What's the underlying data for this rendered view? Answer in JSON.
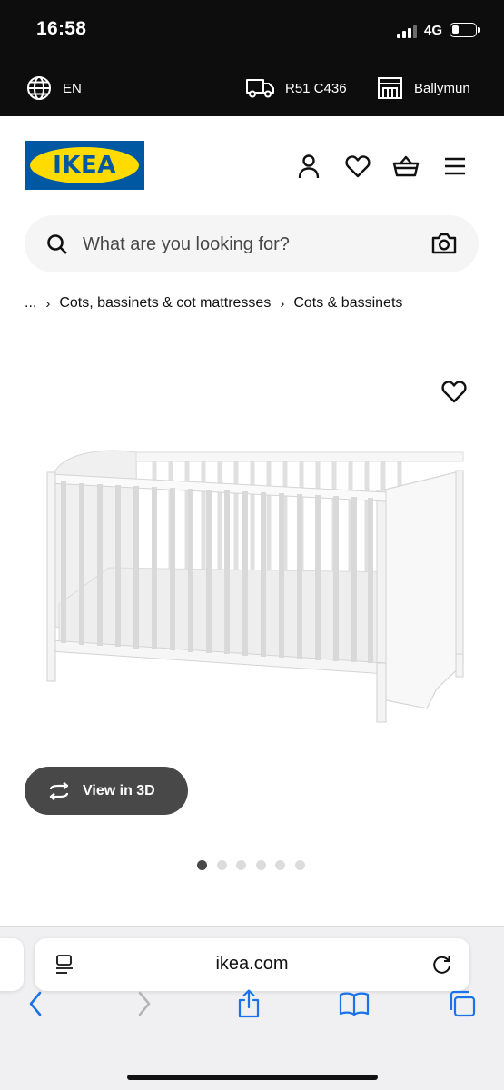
{
  "status_bar": {
    "time": "16:58",
    "network": "4G"
  },
  "locale_bar": {
    "language": "EN",
    "delivery_location": "R51 C436",
    "store": "Ballymun"
  },
  "header": {
    "logo_text": "IKEA",
    "brand_blue": "#0058a3",
    "brand_yellow": "#ffdb00"
  },
  "search": {
    "placeholder": "What are you looking for?"
  },
  "breadcrumb": {
    "ellipsis": "...",
    "items": [
      "Cots, bassinets & cot mattresses",
      "Cots & bassinets"
    ]
  },
  "product": {
    "view_3d_label": "View in 3D",
    "image_count": 6,
    "active_image_index": 0
  },
  "browser": {
    "url": "ikea.com"
  }
}
